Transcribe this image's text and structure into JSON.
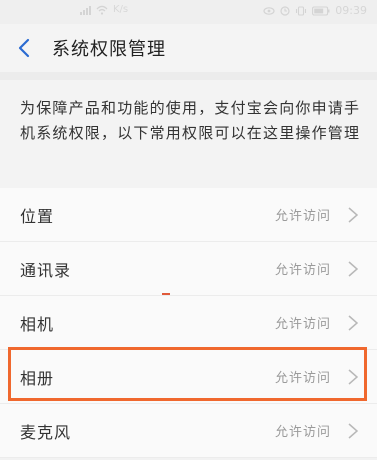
{
  "status_bar": {
    "network": "K/s",
    "time": "09:39",
    "icons": [
      "signal-icon",
      "wifi-icon",
      "eye-comfort-icon",
      "alarm-icon",
      "vibrate-icon",
      "battery-icon"
    ]
  },
  "header": {
    "back_icon": "chevron-left-icon",
    "title": "系统权限管理"
  },
  "notice": {
    "text": "为保障产品和功能的使用，支付宝会向你申请手机系统权限，以下常用权限可以在这里操作管理"
  },
  "permissions": [
    {
      "label": "位置",
      "status": "允许访问"
    },
    {
      "label": "通讯录",
      "status": "允许访问"
    },
    {
      "label": "相机",
      "status": "允许访问"
    },
    {
      "label": "相册",
      "status": "允许访问",
      "highlighted": true
    },
    {
      "label": "麦克风",
      "status": "允许访问"
    }
  ],
  "colors": {
    "highlight_border": "#f0682e",
    "back_arrow": "#2b6bd1"
  }
}
